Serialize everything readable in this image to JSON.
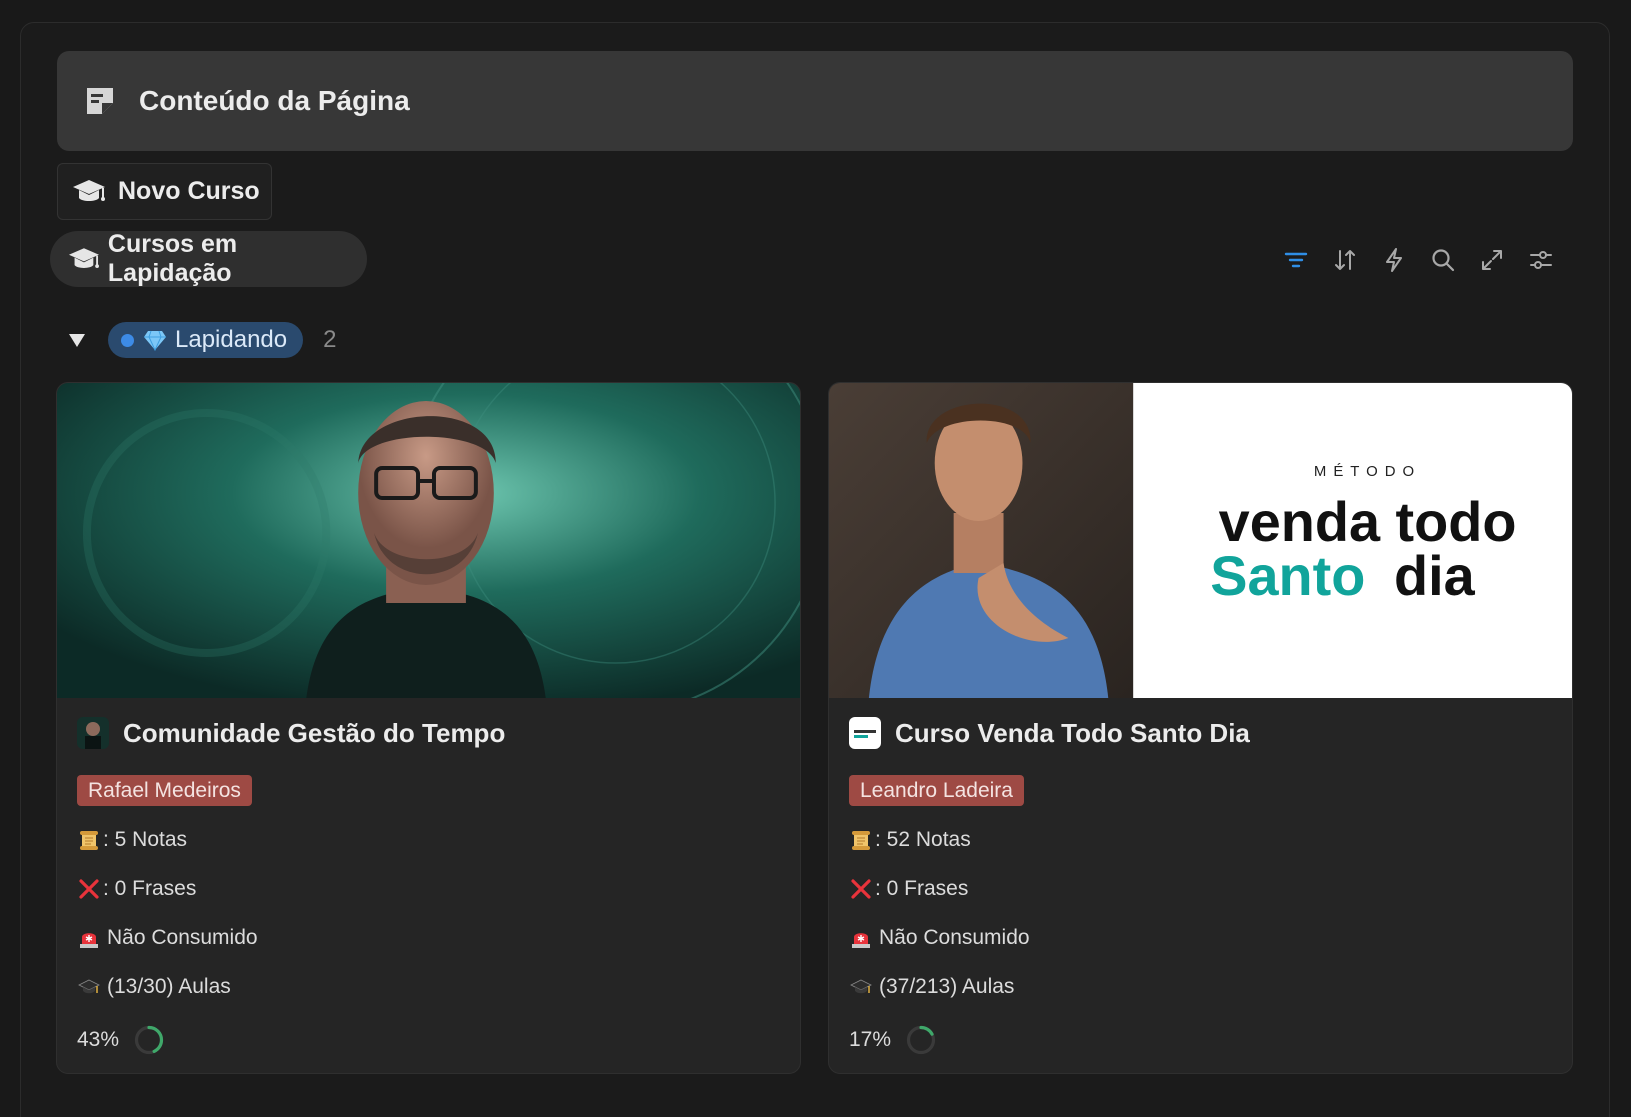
{
  "callout": {
    "title": "Conteúdo da Página",
    "icon": "document-icon"
  },
  "new_button": {
    "label": "Novo Curso",
    "icon": "graduation-cap-icon"
  },
  "view_tab": {
    "label": "Cursos em Lapidação",
    "icon": "graduation-cap-icon"
  },
  "toolbar": {
    "active_color": "#2f8ee6",
    "icons": [
      "filter-icon",
      "sort-icon",
      "automation-icon",
      "search-icon",
      "expand-icon",
      "settings-icon"
    ]
  },
  "group": {
    "label": "Lapidando",
    "count": "2",
    "emoji": "gem"
  },
  "cards": [
    {
      "title": "Comunidade Gestão do Tempo",
      "author": "Rafael Medeiros",
      "notes": ": 5 Notas",
      "frases": ": 0 Frases",
      "status": "Não Consumido",
      "aulas": "(13/30) Aulas",
      "progress_label": "43%",
      "progress": 0.43
    },
    {
      "title": "Curso Venda Todo Santo Dia",
      "author": "Leandro Ladeira",
      "notes": ": 52 Notas",
      "frases": ": 0 Frases",
      "status": "Não Consumido",
      "aulas": "(37/213) Aulas",
      "progress_label": "17%",
      "progress": 0.17,
      "cover_text": {
        "small": "MÉTODO",
        "line1": "venda todo",
        "line2a": "Santo",
        "line2b": "dia"
      }
    }
  ]
}
